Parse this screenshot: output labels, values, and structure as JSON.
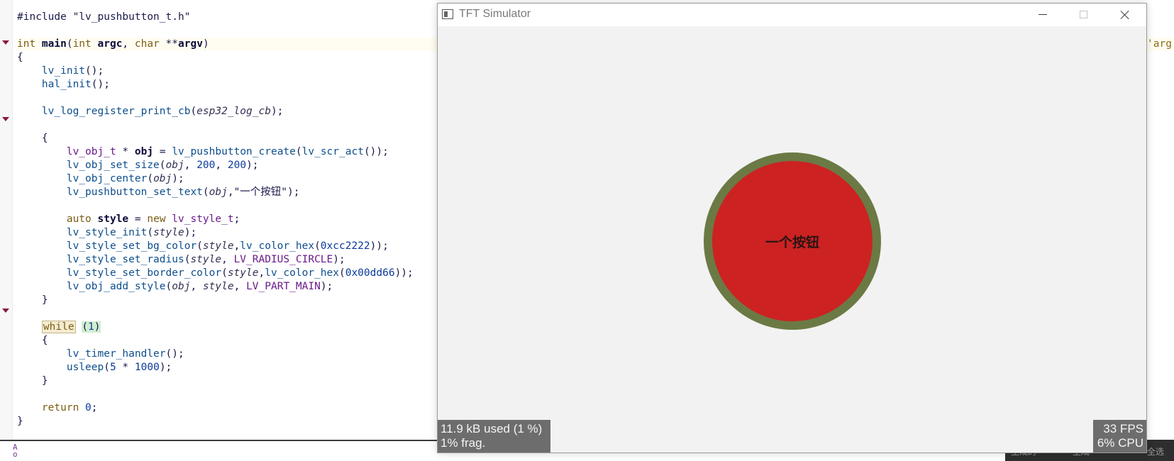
{
  "editor": {
    "lines": [
      {
        "parts": [
          {
            "t": "#include \"lv_pushbutton_t.h\"",
            "c": ""
          }
        ]
      },
      {
        "parts": []
      },
      {
        "parts": [
          {
            "t": "int ",
            "c": "kw"
          },
          {
            "t": "main",
            "c": "bold"
          },
          {
            "t": "(",
            "c": ""
          },
          {
            "t": "int ",
            "c": "kw"
          },
          {
            "t": "argc",
            "c": "bold"
          },
          {
            "t": ", ",
            "c": ""
          },
          {
            "t": "char ",
            "c": "kw"
          },
          {
            "t": "**",
            "c": ""
          },
          {
            "t": "argv",
            "c": "bold"
          },
          {
            "t": ")",
            "c": ""
          }
        ]
      },
      {
        "parts": [
          {
            "t": "{",
            "c": ""
          }
        ]
      },
      {
        "parts": [
          {
            "t": "    ",
            "c": ""
          },
          {
            "t": "lv_init",
            "c": "fn"
          },
          {
            "t": "();",
            "c": ""
          }
        ]
      },
      {
        "parts": [
          {
            "t": "    ",
            "c": ""
          },
          {
            "t": "hal_init",
            "c": "fn"
          },
          {
            "t": "();",
            "c": ""
          }
        ]
      },
      {
        "parts": []
      },
      {
        "parts": [
          {
            "t": "    ",
            "c": ""
          },
          {
            "t": "lv_log_register_print_cb",
            "c": "fn"
          },
          {
            "t": "(",
            "c": ""
          },
          {
            "t": "esp32_log_cb",
            "c": "param"
          },
          {
            "t": ");",
            "c": ""
          }
        ]
      },
      {
        "parts": []
      },
      {
        "parts": [
          {
            "t": "    {",
            "c": ""
          }
        ]
      },
      {
        "parts": [
          {
            "t": "        ",
            "c": ""
          },
          {
            "t": "lv_obj_t",
            "c": "type"
          },
          {
            "t": " * ",
            "c": ""
          },
          {
            "t": "obj",
            "c": "bold"
          },
          {
            "t": " = ",
            "c": ""
          },
          {
            "t": "lv_pushbutton_create",
            "c": "fn"
          },
          {
            "t": "(",
            "c": ""
          },
          {
            "t": "lv_scr_act",
            "c": "fn"
          },
          {
            "t": "());",
            "c": ""
          }
        ]
      },
      {
        "parts": [
          {
            "t": "        ",
            "c": ""
          },
          {
            "t": "lv_obj_set_size",
            "c": "fn"
          },
          {
            "t": "(",
            "c": ""
          },
          {
            "t": "obj",
            "c": "param"
          },
          {
            "t": ", ",
            "c": ""
          },
          {
            "t": "200",
            "c": "num"
          },
          {
            "t": ", ",
            "c": ""
          },
          {
            "t": "200",
            "c": "num"
          },
          {
            "t": ");",
            "c": ""
          }
        ]
      },
      {
        "parts": [
          {
            "t": "        ",
            "c": ""
          },
          {
            "t": "lv_obj_center",
            "c": "fn"
          },
          {
            "t": "(",
            "c": ""
          },
          {
            "t": "obj",
            "c": "param"
          },
          {
            "t": ");",
            "c": ""
          }
        ]
      },
      {
        "parts": [
          {
            "t": "        ",
            "c": ""
          },
          {
            "t": "lv_pushbutton_set_text",
            "c": "fn"
          },
          {
            "t": "(",
            "c": ""
          },
          {
            "t": "obj",
            "c": "param"
          },
          {
            "t": ",\"一个按钮\");",
            "c": "str"
          }
        ]
      },
      {
        "parts": []
      },
      {
        "parts": [
          {
            "t": "        ",
            "c": ""
          },
          {
            "t": "auto ",
            "c": "kw"
          },
          {
            "t": "style",
            "c": "bold"
          },
          {
            "t": " = ",
            "c": ""
          },
          {
            "t": "new ",
            "c": "kw"
          },
          {
            "t": "lv_style_t",
            "c": "type"
          },
          {
            "t": ";",
            "c": ""
          }
        ]
      },
      {
        "parts": [
          {
            "t": "        ",
            "c": ""
          },
          {
            "t": "lv_style_init",
            "c": "fn"
          },
          {
            "t": "(",
            "c": ""
          },
          {
            "t": "style",
            "c": "param"
          },
          {
            "t": ");",
            "c": ""
          }
        ]
      },
      {
        "parts": [
          {
            "t": "        ",
            "c": ""
          },
          {
            "t": "lv_style_set_bg_color",
            "c": "fn"
          },
          {
            "t": "(",
            "c": ""
          },
          {
            "t": "style",
            "c": "param"
          },
          {
            "t": ",",
            "c": ""
          },
          {
            "t": "lv_color_hex",
            "c": "fn"
          },
          {
            "t": "(",
            "c": ""
          },
          {
            "t": "0xcc2222",
            "c": "num"
          },
          {
            "t": "));",
            "c": ""
          }
        ]
      },
      {
        "parts": [
          {
            "t": "        ",
            "c": ""
          },
          {
            "t": "lv_style_set_radius",
            "c": "fn"
          },
          {
            "t": "(",
            "c": ""
          },
          {
            "t": "style",
            "c": "param"
          },
          {
            "t": ", ",
            "c": ""
          },
          {
            "t": "LV_RADIUS_CIRCLE",
            "c": "macro"
          },
          {
            "t": ");",
            "c": ""
          }
        ]
      },
      {
        "parts": [
          {
            "t": "        ",
            "c": ""
          },
          {
            "t": "lv_style_set_border_color",
            "c": "fn"
          },
          {
            "t": "(",
            "c": ""
          },
          {
            "t": "style",
            "c": "param"
          },
          {
            "t": ",",
            "c": ""
          },
          {
            "t": "lv_color_hex",
            "c": "fn"
          },
          {
            "t": "(",
            "c": ""
          },
          {
            "t": "0x00dd66",
            "c": "num"
          },
          {
            "t": "));",
            "c": ""
          }
        ]
      },
      {
        "parts": [
          {
            "t": "        ",
            "c": ""
          },
          {
            "t": "lv_obj_add_style",
            "c": "fn"
          },
          {
            "t": "(",
            "c": ""
          },
          {
            "t": "obj",
            "c": "param"
          },
          {
            "t": ", ",
            "c": ""
          },
          {
            "t": "style",
            "c": "param"
          },
          {
            "t": ", ",
            "c": ""
          },
          {
            "t": "LV_PART_MAIN",
            "c": "macro"
          },
          {
            "t": ");",
            "c": ""
          }
        ]
      },
      {
        "parts": [
          {
            "t": "    }",
            "c": ""
          }
        ]
      },
      {
        "parts": []
      },
      {
        "parts": [
          {
            "t": "    ",
            "c": ""
          },
          {
            "t": "while",
            "c": "kw hl"
          },
          {
            "t": " ",
            "c": ""
          },
          {
            "t": "(",
            "c": "hlp"
          },
          {
            "t": "1",
            "c": "num hlp"
          },
          {
            "t": ")",
            "c": "hlp"
          }
        ]
      },
      {
        "parts": [
          {
            "t": "    {",
            "c": ""
          }
        ]
      },
      {
        "parts": [
          {
            "t": "        ",
            "c": ""
          },
          {
            "t": "lv_timer_handler",
            "c": "fn"
          },
          {
            "t": "();",
            "c": ""
          }
        ]
      },
      {
        "parts": [
          {
            "t": "        ",
            "c": ""
          },
          {
            "t": "usleep",
            "c": "fn"
          },
          {
            "t": "(",
            "c": ""
          },
          {
            "t": "5",
            "c": "num"
          },
          {
            "t": " * ",
            "c": ""
          },
          {
            "t": "1000",
            "c": "num"
          },
          {
            "t": ");",
            "c": ""
          }
        ]
      },
      {
        "parts": [
          {
            "t": "    }",
            "c": ""
          }
        ]
      },
      {
        "parts": []
      },
      {
        "parts": [
          {
            "t": "    ",
            "c": ""
          },
          {
            "t": "return ",
            "c": "kw"
          },
          {
            "t": "0",
            "c": "num"
          },
          {
            "t": ";",
            "c": ""
          }
        ]
      },
      {
        "parts": [
          {
            "t": "}",
            "c": ""
          }
        ]
      }
    ],
    "right_peek": "'arg",
    "status_glyph": "A\no",
    "taskbar_items": [
      "生成的",
      "生成",
      "全选"
    ]
  },
  "simulator": {
    "title": "TFT Simulator",
    "minimize_icon": "minimize-icon",
    "maximize_icon": "maximize-icon",
    "close_icon": "close-icon",
    "button_label": "一个按钮",
    "button_bg_color": "#cc2222",
    "button_border_color": "#6b7a44",
    "mem_used": "11.9 kB used (1 %)",
    "mem_frag": "1% frag.",
    "fps": "33 FPS",
    "cpu": "6% CPU"
  }
}
